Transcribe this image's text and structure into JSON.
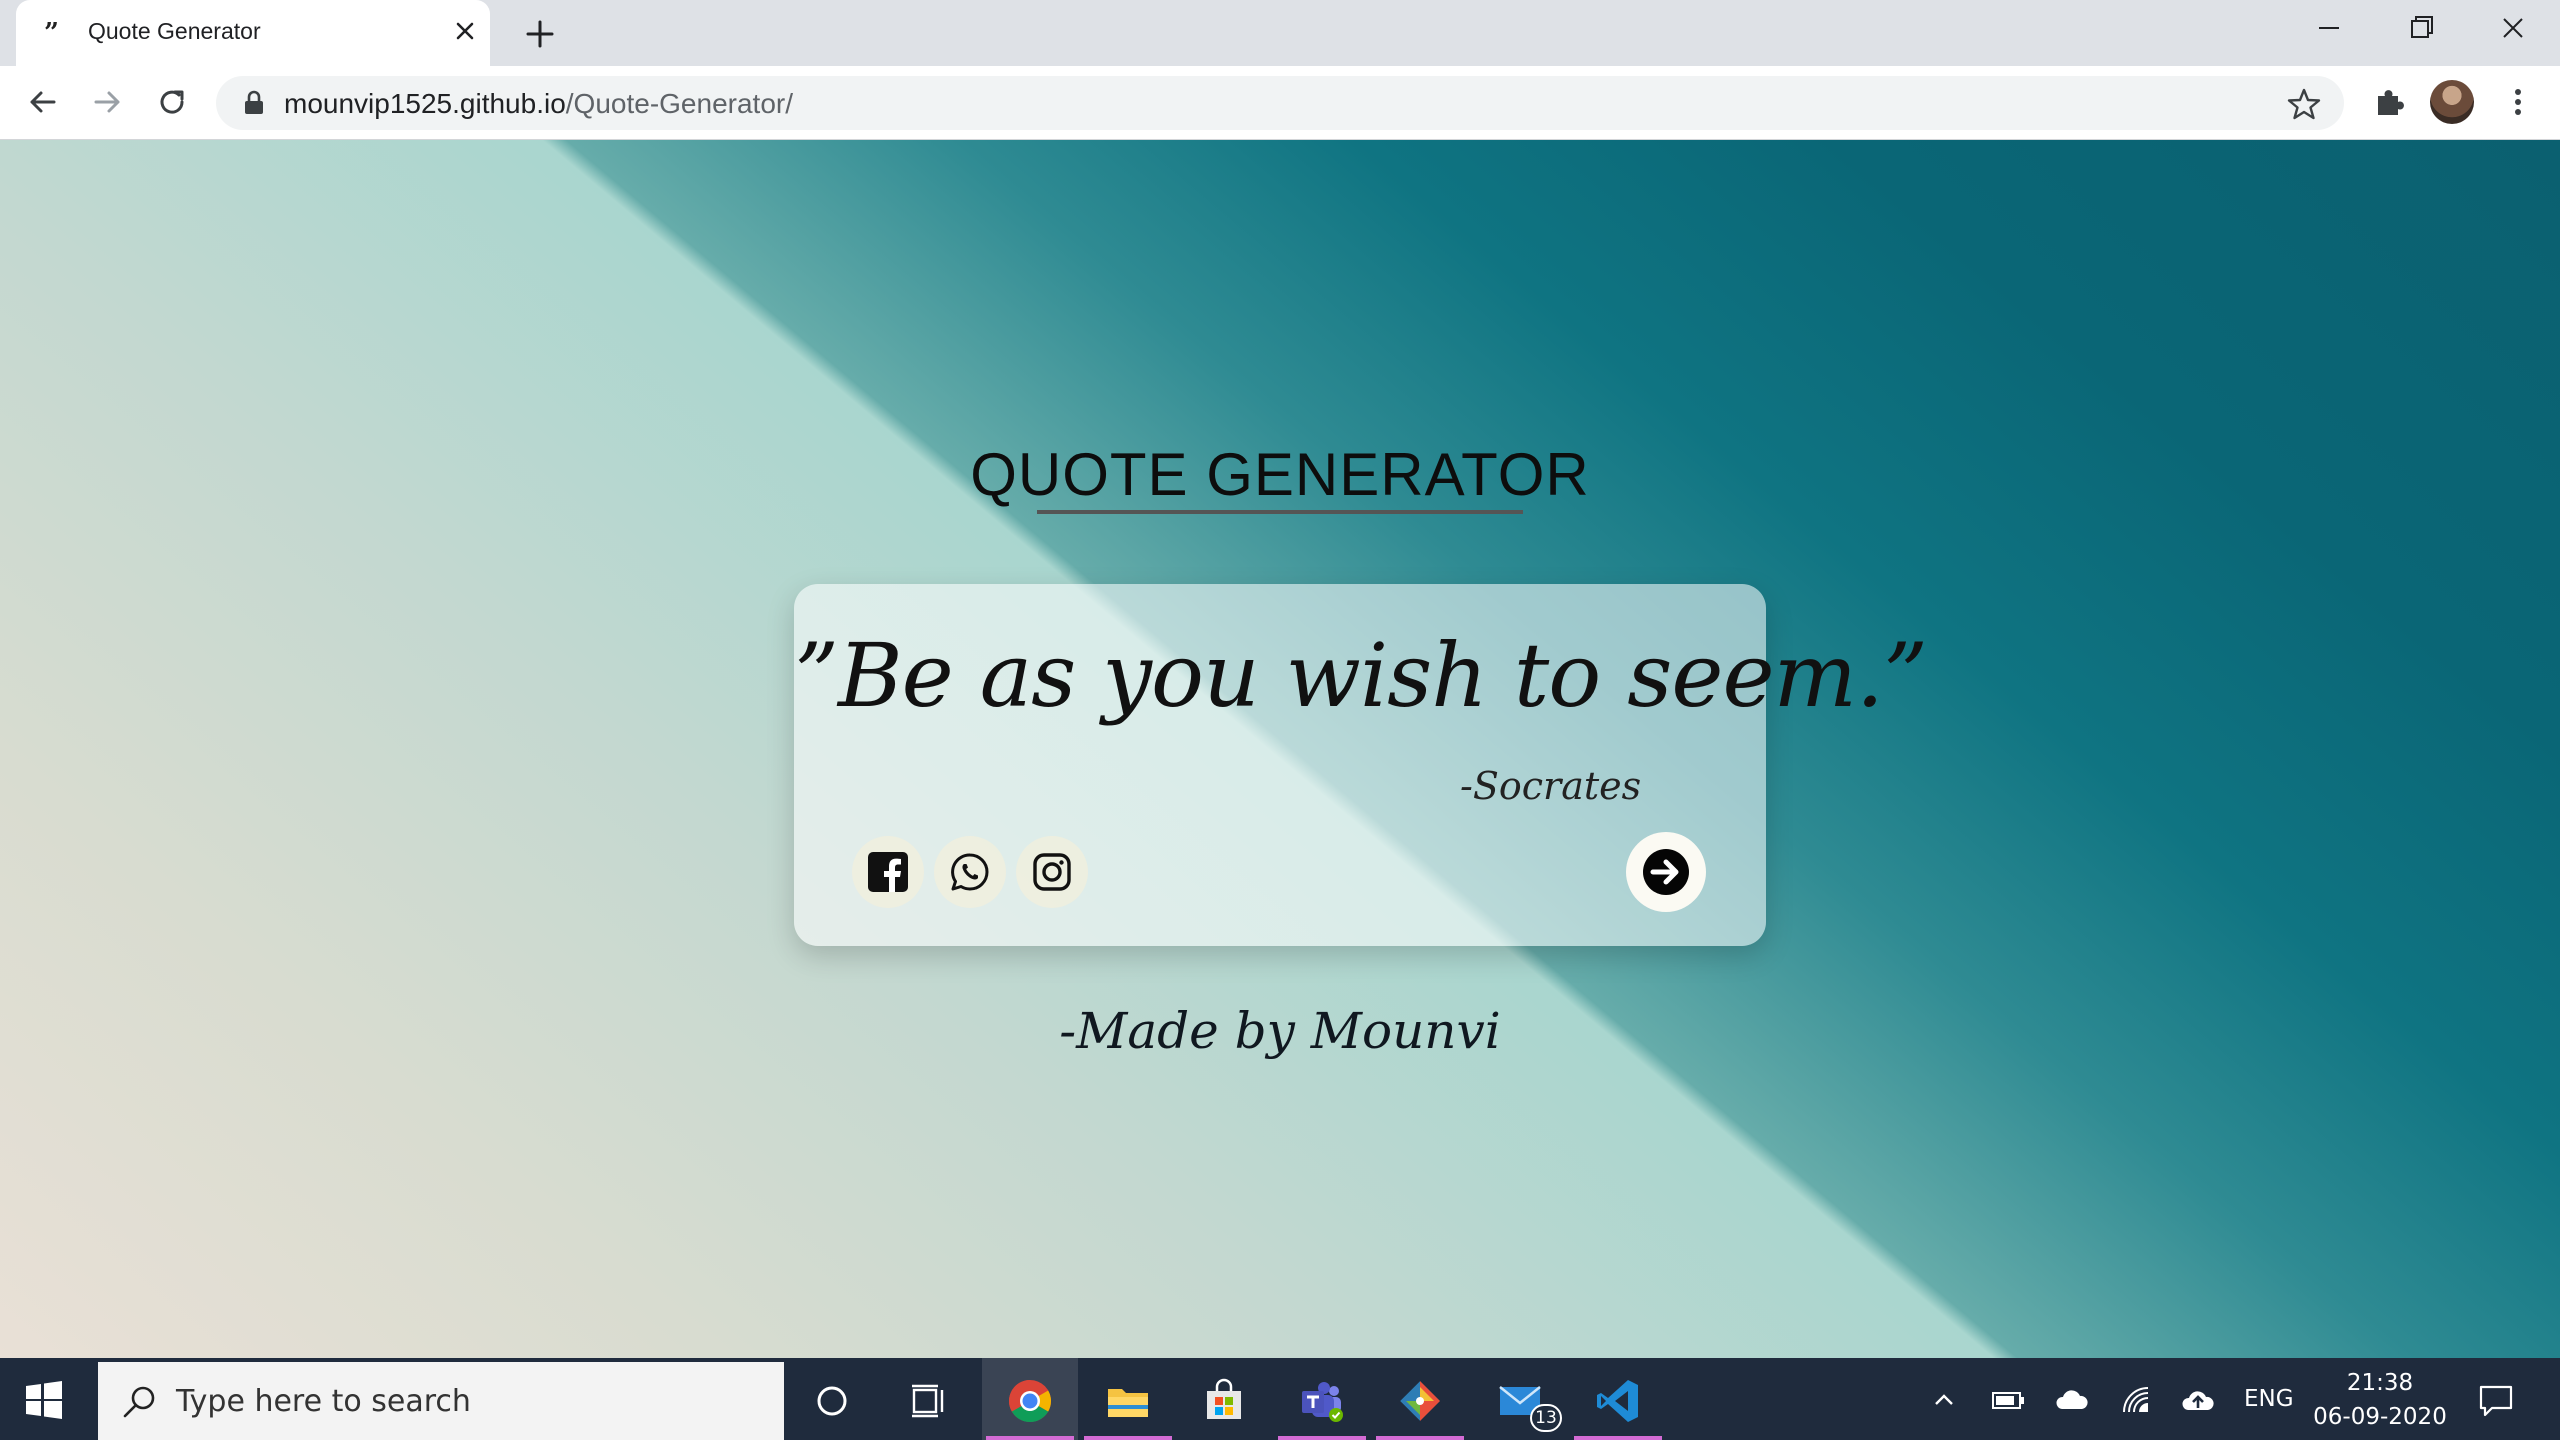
{
  "browser": {
    "tab_title": "Quote Generator",
    "tab_favicon": "”",
    "url_host": "mounvip1525.github.io",
    "url_path": "/Quote-Generator/"
  },
  "page": {
    "title": "QUOTE GENERATOR",
    "quote": "”Be as you wish to seem.”",
    "author": "-Socrates",
    "footer": "-Made by Mounvi",
    "social_icons": [
      "facebook-icon",
      "whatsapp-icon",
      "instagram-icon"
    ],
    "next_icon": "arrow-right-circle-icon"
  },
  "taskbar": {
    "search_placeholder": "Type here to search",
    "apps": [
      "cortana-icon",
      "task-view-icon",
      "chrome-icon",
      "file-explorer-icon",
      "microsoft-store-icon",
      "teams-icon",
      "git-icon",
      "mail-icon",
      "vscode-icon"
    ],
    "mail_badge": "13",
    "language": "ENG",
    "time": "21:38",
    "date": "06-09-2020"
  },
  "colors": {
    "accent_indicator": "#d36bd4",
    "taskbar_bg": "#1f2b3d",
    "teal_dark": "#0a6676"
  }
}
